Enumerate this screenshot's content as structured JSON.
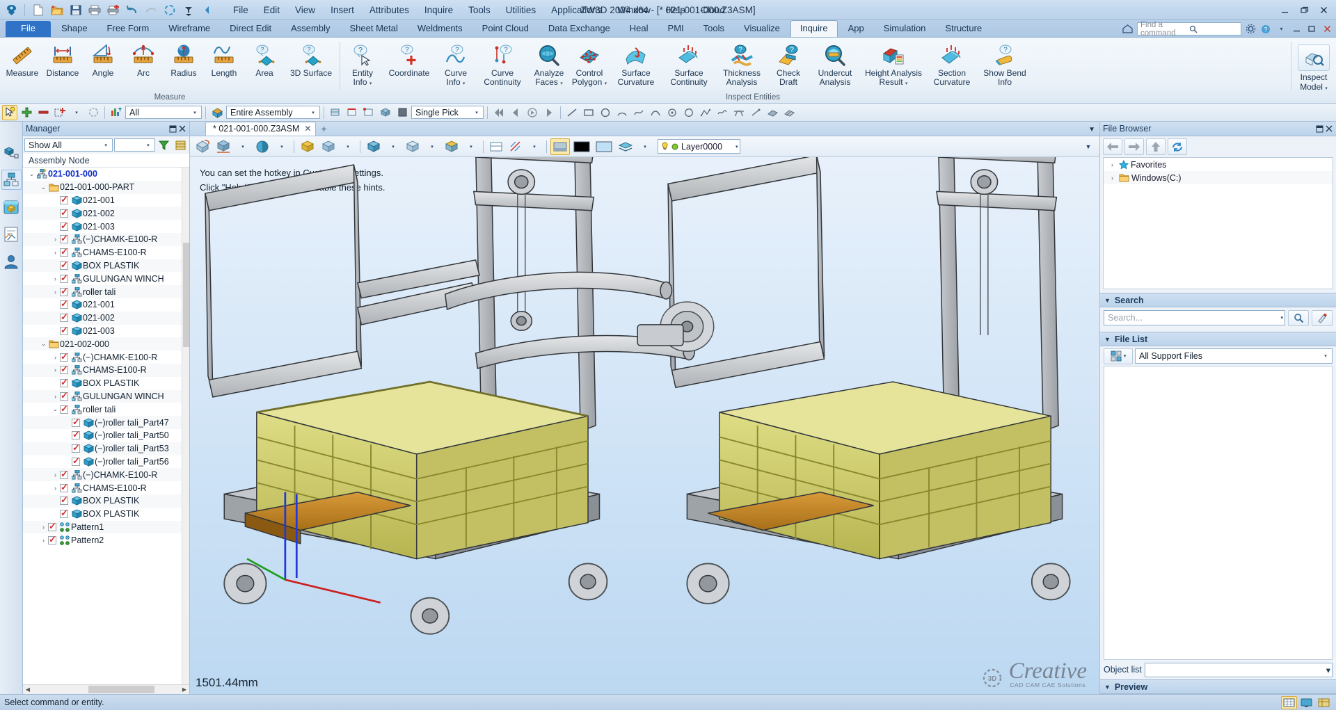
{
  "app": {
    "title": "ZW3D 2024 x64 - [* 021-001-000.Z3ASM]",
    "window_controls": [
      "minimize",
      "restore",
      "close"
    ]
  },
  "quick_access": [
    {
      "name": "zw3d-logo-icon",
      "label": "ZW3D"
    },
    {
      "name": "new-file-icon",
      "label": "New"
    },
    {
      "name": "open-file-icon",
      "label": "Open"
    },
    {
      "name": "save-icon",
      "label": "Save"
    },
    {
      "name": "print-icon",
      "label": "Print"
    },
    {
      "name": "print-add-icon",
      "label": "Print Preview"
    },
    {
      "name": "undo-icon",
      "label": "Undo"
    },
    {
      "name": "redo-icon",
      "label": "Redo"
    },
    {
      "name": "regen-icon",
      "label": "Regen"
    },
    {
      "name": "filter-icon",
      "label": "Filter"
    },
    {
      "name": "back-arrow-icon",
      "label": "Back"
    }
  ],
  "menubar": [
    "File",
    "Edit",
    "View",
    "Insert",
    "Attributes",
    "Inquire",
    "Tools",
    "Utilities",
    "Applications",
    "Window",
    "Help",
    "Cloud"
  ],
  "ribbon_tabs": {
    "file_label": "File",
    "tabs": [
      "Shape",
      "Free Form",
      "Wireframe",
      "Direct Edit",
      "Assembly",
      "Sheet Metal",
      "Weldments",
      "Point Cloud",
      "Data Exchange",
      "Heal",
      "PMI",
      "Tools",
      "Visualize",
      "Inquire",
      "App",
      "Simulation",
      "Structure"
    ],
    "active": "Inquire"
  },
  "command_search": {
    "placeholder": "Find a command",
    "icon": "search-icon"
  },
  "ribbon": {
    "groups": [
      {
        "label": "Measure",
        "buttons": [
          {
            "label": "Measure",
            "icon": "ruler-icon",
            "dropdown": false
          },
          {
            "label": "Distance",
            "icon": "distance-icon",
            "dropdown": false
          },
          {
            "label": "Angle",
            "icon": "angle-icon",
            "dropdown": false
          },
          {
            "label": "Arc",
            "icon": "arc-icon",
            "dropdown": false
          },
          {
            "label": "Radius",
            "icon": "radius-icon",
            "dropdown": false
          },
          {
            "label": "Length",
            "icon": "length-icon",
            "dropdown": false
          },
          {
            "label": "Area",
            "icon": "area-icon",
            "dropdown": false
          },
          {
            "label": "3D Surface",
            "icon": "3d-surface-icon",
            "dropdown": false
          }
        ]
      },
      {
        "label": "Inspect Entities",
        "buttons": [
          {
            "label": "Entity\nInfo",
            "icon": "entity-info-icon",
            "dropdown": true
          },
          {
            "label": "Coordinate",
            "icon": "coordinate-icon",
            "dropdown": false
          },
          {
            "label": "Curve\nInfo",
            "icon": "curve-info-icon",
            "dropdown": true
          },
          {
            "label": "Curve\nContinuity",
            "icon": "curve-continuity-icon",
            "dropdown": false
          },
          {
            "label": "Analyze\nFaces",
            "icon": "analyze-faces-icon",
            "dropdown": true
          },
          {
            "label": "Control\nPolygon",
            "icon": "control-polygon-icon",
            "dropdown": true
          },
          {
            "label": "Surface\nCurvature",
            "icon": "surface-curvature-icon",
            "dropdown": false
          },
          {
            "label": "Surface\nContinuity",
            "icon": "surface-continuity-icon",
            "dropdown": false
          },
          {
            "label": "Thickness\nAnalysis",
            "icon": "thickness-analysis-icon",
            "dropdown": false
          },
          {
            "label": "Check\nDraft",
            "icon": "check-draft-icon",
            "dropdown": false
          },
          {
            "label": "Undercut\nAnalysis",
            "icon": "undercut-analysis-icon",
            "dropdown": false
          },
          {
            "label": "Height Analysis\nResult",
            "icon": "height-analysis-icon",
            "dropdown": true
          },
          {
            "label": "Section\nCurvature",
            "icon": "section-curvature-icon",
            "dropdown": false
          },
          {
            "label": "Show Bend\nInfo",
            "icon": "show-bend-info-icon",
            "dropdown": false
          }
        ]
      },
      {
        "label": "",
        "buttons": [
          {
            "label": "Inspect\nModel",
            "icon": "inspect-model-icon",
            "dropdown": true
          }
        ]
      }
    ]
  },
  "toolbar2": {
    "filter_combo": "All",
    "scope_combo": "Entire Assembly",
    "pick_combo": "Single Pick"
  },
  "manager": {
    "title": "Manager",
    "filter_combo": "Show All",
    "tree_header": "Assembly Node",
    "tree": [
      {
        "indent": 0,
        "expand": "v",
        "check": false,
        "icon": "assembly-root-icon",
        "label": "021-001-000",
        "root": true
      },
      {
        "indent": 1,
        "expand": "v",
        "check": false,
        "icon": "folder-icon",
        "label": "021-001-000-PART"
      },
      {
        "indent": 2,
        "expand": "",
        "check": true,
        "icon": "part-icon",
        "label": "021-001"
      },
      {
        "indent": 2,
        "expand": "",
        "check": true,
        "icon": "part-icon",
        "label": "021-002"
      },
      {
        "indent": 2,
        "expand": "",
        "check": true,
        "icon": "part-icon",
        "label": "021-003"
      },
      {
        "indent": 2,
        "expand": ">",
        "check": true,
        "icon": "subassembly-icon",
        "label": "(−)CHAMK-E100-R"
      },
      {
        "indent": 2,
        "expand": ">",
        "check": true,
        "icon": "subassembly-icon",
        "label": "CHAMS-E100-R"
      },
      {
        "indent": 2,
        "expand": "",
        "check": true,
        "icon": "part-icon",
        "label": "BOX PLASTIK"
      },
      {
        "indent": 2,
        "expand": ">",
        "check": true,
        "icon": "subassembly-icon",
        "label": "GULUNGAN WINCH"
      },
      {
        "indent": 2,
        "expand": ">",
        "check": true,
        "icon": "subassembly-icon",
        "label": "roller tali"
      },
      {
        "indent": 2,
        "expand": "",
        "check": true,
        "icon": "part-icon",
        "label": "021-001"
      },
      {
        "indent": 2,
        "expand": "",
        "check": true,
        "icon": "part-icon",
        "label": "021-002"
      },
      {
        "indent": 2,
        "expand": "",
        "check": true,
        "icon": "part-icon",
        "label": "021-003"
      },
      {
        "indent": 1,
        "expand": "v",
        "check": false,
        "icon": "folder-icon",
        "label": "021-002-000"
      },
      {
        "indent": 2,
        "expand": ">",
        "check": true,
        "icon": "subassembly-icon",
        "label": "(−)CHAMK-E100-R"
      },
      {
        "indent": 2,
        "expand": ">",
        "check": true,
        "icon": "subassembly-icon",
        "label": "CHAMS-E100-R"
      },
      {
        "indent": 2,
        "expand": "",
        "check": true,
        "icon": "part-icon",
        "label": "BOX PLASTIK"
      },
      {
        "indent": 2,
        "expand": ">",
        "check": true,
        "icon": "subassembly-icon",
        "label": "GULUNGAN WINCH"
      },
      {
        "indent": 2,
        "expand": "v",
        "check": true,
        "icon": "subassembly-icon",
        "label": "roller tali"
      },
      {
        "indent": 3,
        "expand": "",
        "check": true,
        "icon": "part-icon",
        "label": "(−)roller tali_Part47"
      },
      {
        "indent": 3,
        "expand": "",
        "check": true,
        "icon": "part-icon",
        "label": "(−)roller tali_Part50"
      },
      {
        "indent": 3,
        "expand": "",
        "check": true,
        "icon": "part-icon",
        "label": "(−)roller tali_Part53"
      },
      {
        "indent": 3,
        "expand": "",
        "check": true,
        "icon": "part-icon",
        "label": "(−)roller tali_Part56"
      },
      {
        "indent": 2,
        "expand": ">",
        "check": true,
        "icon": "subassembly-icon",
        "label": "(−)CHAMK-E100-R"
      },
      {
        "indent": 2,
        "expand": ">",
        "check": true,
        "icon": "subassembly-icon",
        "label": "CHAMS-E100-R"
      },
      {
        "indent": 2,
        "expand": "",
        "check": true,
        "icon": "part-icon",
        "label": "BOX PLASTIK"
      },
      {
        "indent": 2,
        "expand": "",
        "check": true,
        "icon": "part-icon",
        "label": "BOX PLASTIK"
      },
      {
        "indent": 1,
        "expand": ">",
        "check": true,
        "icon": "pattern-icon",
        "label": "Pattern1"
      },
      {
        "indent": 1,
        "expand": ">",
        "check": true,
        "icon": "pattern-icon",
        "label": "Pattern2"
      }
    ]
  },
  "document_tabs": {
    "tabs": [
      {
        "label": "* 021-001-000.Z3ASM",
        "close": "✕"
      }
    ],
    "add_label": "+"
  },
  "viewport": {
    "hint_line1": "You can set the hotkey in Customize Settings.",
    "hint_line2": "Click \"Help/Show Hints\" to disable these hints.",
    "dimension_label": "1501.44mm",
    "layer_combo": "Layer0000",
    "watermark_main": "Creative",
    "watermark_sub": "CAD CAM CAE Solutions",
    "watermark_badge": "3D"
  },
  "file_browser": {
    "title": "File Browser",
    "tree": [
      {
        "icon": "star-icon",
        "label": "Favorites"
      },
      {
        "icon": "folder-icon",
        "label": "Windows(C:)"
      }
    ],
    "search_section": "Search",
    "search_placeholder": "Search...",
    "file_list_section": "File List",
    "file_filter": "All Support Files",
    "object_list_label": "Object list",
    "preview_section": "Preview"
  },
  "status_bar": {
    "message": "Select command or entity."
  },
  "colors": {
    "accent_blue": "#2f72c6",
    "titlebar": "#c3d8ee",
    "ribbon_bg": "#eaf1f8",
    "tree_root_text": "#1030c8",
    "check_red": "#d42d2d",
    "viewport_top": "#e8f1fb",
    "viewport_bottom": "#bcd8f1"
  }
}
